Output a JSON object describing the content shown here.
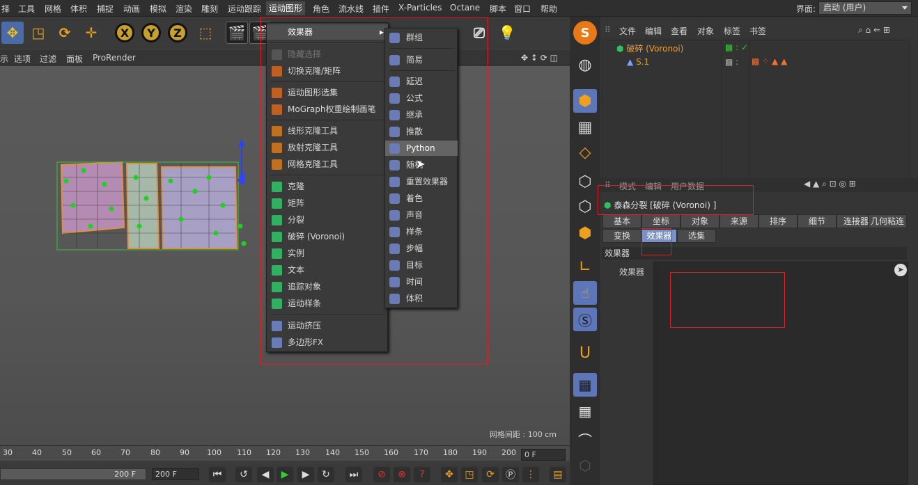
{
  "menubar": {
    "items": [
      "择",
      "工具",
      "网格",
      "体积",
      "捕捉",
      "动画",
      "模拟",
      "渲染",
      "雕刻",
      "运动跟踪",
      "运动图形",
      "角色",
      "流水线",
      "插件",
      "X-Particles",
      "Octane",
      "脚本",
      "窗口",
      "帮助"
    ],
    "active": "运动图形",
    "layout_label": "界面:",
    "layout_value": "启动 (用户)"
  },
  "viewport_menu": [
    "示",
    "选项",
    "过滤",
    "面板",
    "ProRender"
  ],
  "viewport": {
    "grid_spacing": "网格间距 : 100 cm"
  },
  "timeline": {
    "ticks": [
      "30",
      "40",
      "50",
      "60",
      "70",
      "80",
      "90",
      "100",
      "110",
      "120",
      "130",
      "140",
      "150",
      "160",
      "170",
      "180",
      "190",
      "200"
    ],
    "current_frame": "0 F",
    "slider_end": "200 F",
    "end_frame": "200 F"
  },
  "toolbar": {
    "axis_x": "X",
    "axis_y": "Y",
    "axis_z": "Z"
  },
  "mograph_menu": {
    "items": [
      {
        "label": "效果器",
        "submenu": true
      },
      {
        "label": "隐藏选择",
        "dim": true
      },
      {
        "label": "切换克隆/矩阵"
      },
      {
        "label": "运动图形选集"
      },
      {
        "label": "MoGraph权重绘制画笔"
      },
      {
        "label": "线形克隆工具"
      },
      {
        "label": "放射克隆工具"
      },
      {
        "label": "网格克隆工具"
      },
      {
        "label": "克隆"
      },
      {
        "label": "矩阵"
      },
      {
        "label": "分裂"
      },
      {
        "label": "破碎 (Voronoi)"
      },
      {
        "label": "实例"
      },
      {
        "label": "文本"
      },
      {
        "label": "追踪对象"
      },
      {
        "label": "运动样条"
      },
      {
        "label": "运动挤压"
      },
      {
        "label": "多边形FX"
      }
    ]
  },
  "effector_menu": {
    "items": [
      "群组",
      "简易",
      "延迟",
      "公式",
      "继承",
      "推散",
      "Python",
      "随机",
      "重置效果器",
      "着色",
      "声音",
      "样条",
      "步幅",
      "目标",
      "时间",
      "体积"
    ],
    "highlighted": "Python"
  },
  "object_manager": {
    "menu": [
      "文件",
      "编辑",
      "查看",
      "对象",
      "标签",
      "书签"
    ],
    "objects": [
      {
        "name": "破碎 (Voronoi)"
      },
      {
        "name": "S.1"
      }
    ]
  },
  "attribute_manager": {
    "menu": [
      "模式",
      "编辑",
      "用户数据"
    ],
    "title": "泰森分裂 [破碎 (Voronoi) ]",
    "tabs_row1": [
      "基本",
      "坐标",
      "对象",
      "来源",
      "排序",
      "细节",
      "连接器",
      "几何粘连"
    ],
    "tabs_row2": [
      "变换",
      "效果器",
      "选集"
    ],
    "active_tab": "效果器",
    "section": "效果器",
    "field_label": "效果器"
  },
  "colors": {
    "highlight_box": "#e02020",
    "active_tab": "#7c90c4",
    "object_name": "#f0a030"
  }
}
